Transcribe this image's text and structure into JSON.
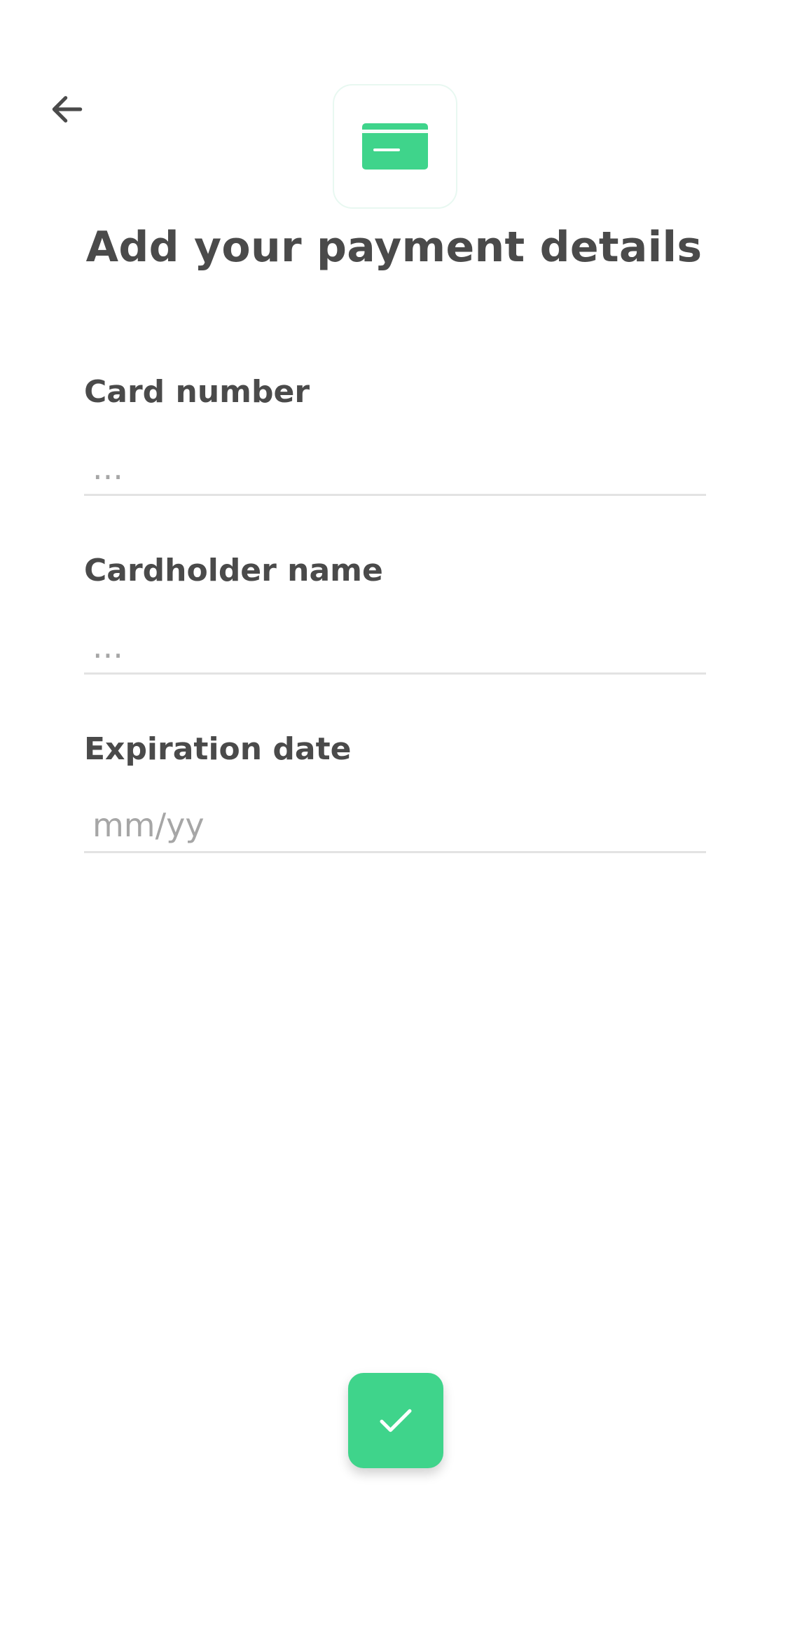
{
  "header": {
    "back_icon": "arrow-left-icon",
    "badge_icon": "credit-card-icon",
    "title": "Add your payment details"
  },
  "form": {
    "card_number": {
      "label": "Card number",
      "value": "",
      "placeholder": "..."
    },
    "cardholder_name": {
      "label": "Cardholder name",
      "value": "",
      "placeholder": "..."
    },
    "expiration_date": {
      "label": "Expiration date",
      "value": "",
      "placeholder": "mm/yy"
    }
  },
  "actions": {
    "confirm_icon": "checkmark-icon"
  },
  "colors": {
    "accent": "#3fd48b",
    "text": "#4a4a4a",
    "placeholder": "#a6a6a6",
    "divider": "#e3e3e3",
    "badge_border": "#e8f8f1"
  }
}
